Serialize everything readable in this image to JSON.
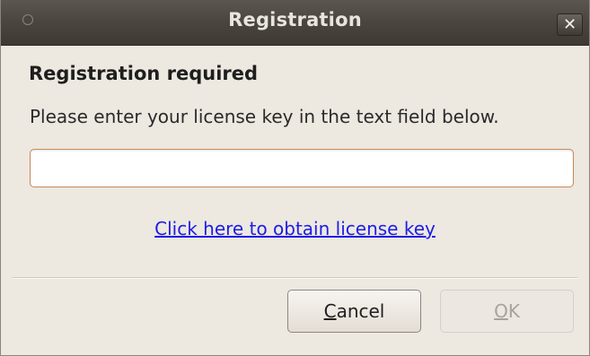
{
  "window": {
    "title": "Registration"
  },
  "content": {
    "heading": "Registration required",
    "instruction": "Please enter your license key in the text field below.",
    "license_input": {
      "value": "",
      "placeholder": ""
    },
    "link_text": "Click here to obtain license key"
  },
  "buttons": {
    "cancel_label": "Cancel",
    "ok_label": "OK",
    "ok_enabled": false
  },
  "icons": {
    "close": "close-icon",
    "window_menu": "window-menu-icon"
  },
  "colors": {
    "titlebar": "#4b4540",
    "dialog_bg": "#ede8e0",
    "link": "#1d1de6",
    "input_border": "#c88a5a",
    "disabled_text": "#a9a39c"
  }
}
